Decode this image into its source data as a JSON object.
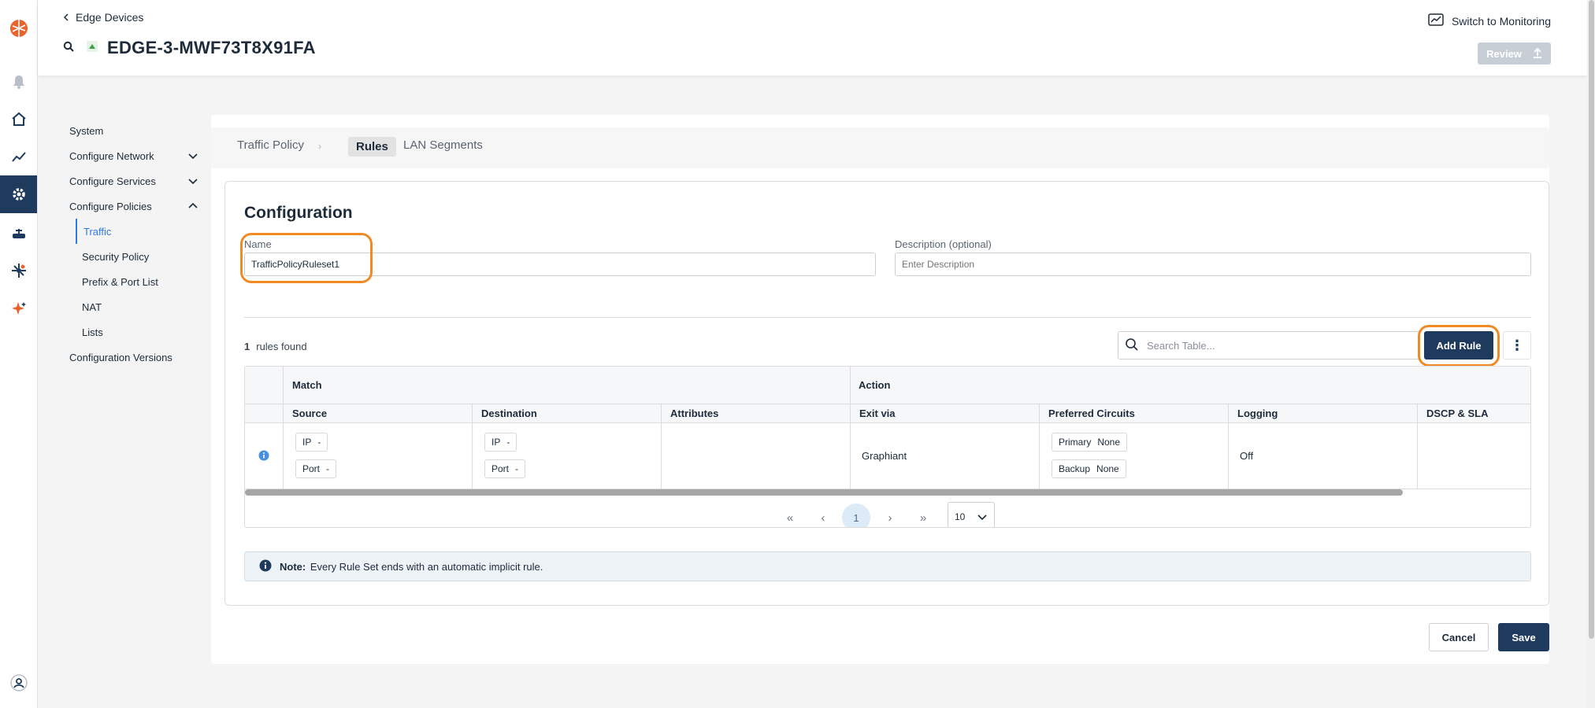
{
  "header": {
    "back_link": "Edge Devices",
    "device_title": "EDGE-3-MWF73T8X91FA",
    "switch_label": "Switch to Monitoring",
    "review_label": "Review"
  },
  "sidebar": {
    "items": [
      {
        "label": "System"
      },
      {
        "label": "Configure Network"
      },
      {
        "label": "Configure Services"
      },
      {
        "label": "Configure Policies"
      },
      {
        "label": "Traffic"
      },
      {
        "label": "Security Policy"
      },
      {
        "label": "Prefix & Port List"
      },
      {
        "label": "NAT"
      },
      {
        "label": "Lists"
      },
      {
        "label": "Configuration Versions"
      }
    ]
  },
  "tabs": {
    "crumb": "Traffic Policy",
    "rules": "Rules",
    "lan": "LAN Segments"
  },
  "config": {
    "heading": "Configuration",
    "name_label": "Name",
    "name_value": "TrafficPolicyRuleset1",
    "desc_label": "Description (optional)",
    "desc_placeholder": "Enter Description",
    "rules_count": "1",
    "rules_found": "rules found",
    "search_placeholder": "Search Table...",
    "add_rule": "Add Rule"
  },
  "table": {
    "groups": [
      "Match",
      "Action"
    ],
    "columns": [
      "Source",
      "Destination",
      "Attributes",
      "Exit via",
      "Preferred Circuits",
      "Logging",
      "DSCP & SLA"
    ],
    "row": {
      "src_ip": "IP",
      "src_port": "Port",
      "dst_ip": "IP",
      "dst_port": "Port",
      "dash": "-",
      "exit_via": "Graphiant",
      "primary_label": "Primary",
      "primary_value": "None",
      "backup_label": "Backup",
      "backup_value": "None",
      "logging": "Off"
    }
  },
  "pagination": {
    "current_page": "1",
    "page_size": "10"
  },
  "note": {
    "label": "Note:",
    "text": "Every Rule Set ends with an automatic implicit rule."
  },
  "footer": {
    "cancel": "Cancel",
    "save": "Save"
  },
  "colors": {
    "primary": "#1e3a5c",
    "accent": "#2f7be5",
    "highlight": "#f08a24",
    "brand": "#e8632b"
  }
}
